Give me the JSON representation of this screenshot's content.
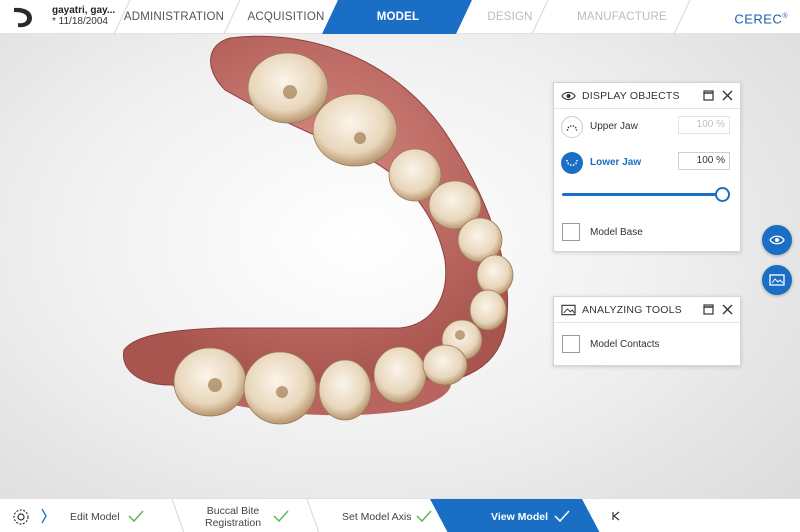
{
  "header": {
    "patient_name": "gayatri, gay...",
    "patient_dob": "* 11/18/2004",
    "steps": [
      {
        "label": "ADMINISTRATION",
        "state": "done"
      },
      {
        "label": "ACQUISITION",
        "state": "done"
      },
      {
        "label": "MODEL",
        "state": "active"
      },
      {
        "label": "DESIGN",
        "state": "disabled"
      },
      {
        "label": "MANUFACTURE",
        "state": "disabled"
      }
    ],
    "brand": "CEREC",
    "brand_mark": "®"
  },
  "display_objects": {
    "title": "DISPLAY OBJECTS",
    "upper_jaw_label": "Upper Jaw",
    "upper_jaw_value": "100 %",
    "lower_jaw_label": "Lower Jaw",
    "lower_jaw_value": "100 %",
    "slider_level": 1.0,
    "model_base_label": "Model Base"
  },
  "analyzing_tools": {
    "title": "ANALYZING TOOLS",
    "model_contacts_label": "Model Contacts"
  },
  "side_buttons": [
    "eye-icon",
    "image-icon"
  ],
  "wizard": {
    "steps": [
      {
        "label": "Edit Model",
        "done": true
      },
      {
        "label": "Buccal Bite",
        "label2": "Registration",
        "done": true
      },
      {
        "label": "Set Model Axis",
        "done": true
      },
      {
        "label": "View Model",
        "done": true,
        "active": true
      }
    ]
  },
  "colors": {
    "accent": "#1a6fc4",
    "gum": "#c96f6a",
    "tooth": "#efe3cf"
  }
}
